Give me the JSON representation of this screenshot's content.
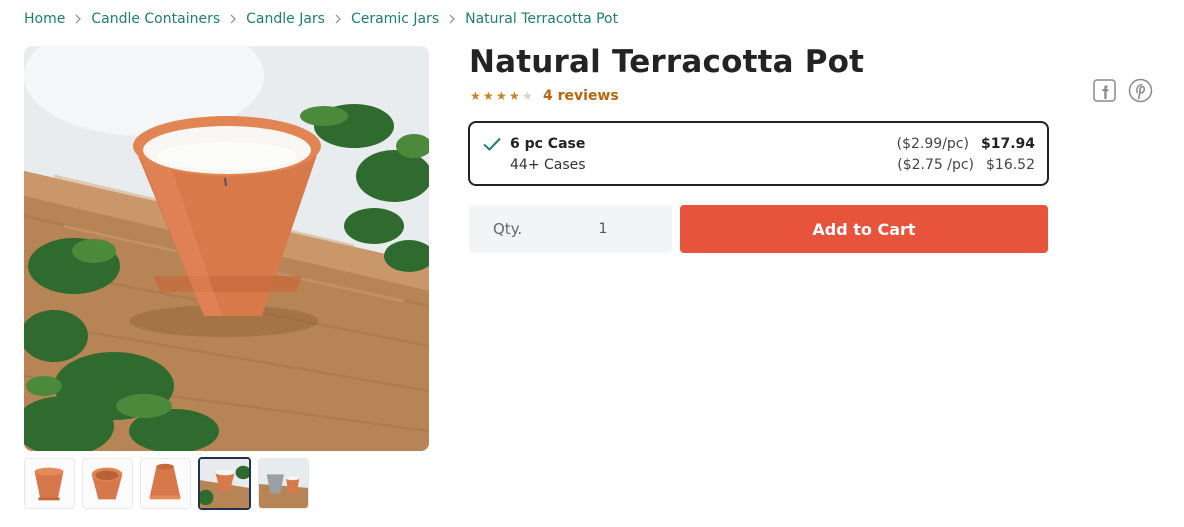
{
  "breadcrumb": {
    "items": [
      "Home",
      "Candle Containers",
      "Candle Jars",
      "Ceramic Jars",
      "Natural Terracotta Pot"
    ]
  },
  "product": {
    "title": "Natural Terracotta Pot",
    "rating": 4,
    "rating_max": 5,
    "reviews_label": "4 reviews"
  },
  "pricing": {
    "options": [
      {
        "name": "6 pc Case",
        "unit_price": "($2.99/pc)",
        "total": "$17.94",
        "selected": true
      },
      {
        "name": "44+ Cases",
        "unit_price": "($2.75 /pc)",
        "total": "$16.52",
        "selected": false
      }
    ]
  },
  "purchase": {
    "qty_label": "Qty.",
    "qty_value": "1",
    "add_to_cart_label": "Add to Cart"
  },
  "social": {
    "icons": [
      "facebook-icon",
      "pinterest-icon"
    ]
  },
  "gallery": {
    "thumbnail_count": 5,
    "active_index": 3
  },
  "colors": {
    "link_green": "#1d7f6e",
    "star": "#cf7d1e",
    "reviews": "#b9650b",
    "cart_button": "#e8533c",
    "check": "#1d7f6e",
    "terracotta": "#d7784a"
  }
}
